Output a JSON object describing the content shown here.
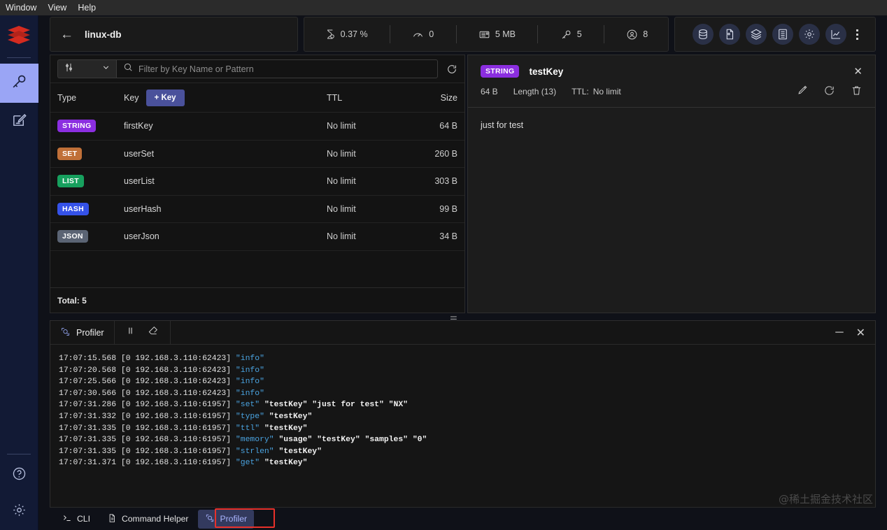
{
  "menubar": {
    "items": [
      "Window",
      "View",
      "Help"
    ]
  },
  "sidebar": {
    "logo": "redis-logo",
    "items": [
      {
        "name": "browser",
        "icon": "key-icon",
        "active": true
      },
      {
        "name": "workbench",
        "icon": "edit-note-icon",
        "active": false
      }
    ],
    "bottom": [
      {
        "name": "help",
        "icon": "question-circle-icon"
      },
      {
        "name": "settings",
        "icon": "gear-icon"
      }
    ]
  },
  "header": {
    "back": "←",
    "db_name": "linux-db",
    "metrics": [
      {
        "icon": "cpu-icon",
        "value": "0.37 %"
      },
      {
        "icon": "gauge-icon",
        "value": "0"
      },
      {
        "icon": "memory-icon",
        "value": "5 MB"
      },
      {
        "icon": "key-icon",
        "value": "5"
      },
      {
        "icon": "clients-icon",
        "value": "8"
      }
    ],
    "tools": [
      "database-icon",
      "report-icon",
      "layers-icon",
      "grid-icon",
      "gear-icon",
      "chart-icon"
    ],
    "overflow": "kebab-icon"
  },
  "keys_panel": {
    "filter": {
      "dropdown_icon": "sliders-icon",
      "chevron": "chevron-down-icon",
      "search_icon": "search-icon",
      "placeholder": "Filter by Key Name or Pattern",
      "value": "",
      "refresh_icon": "refresh-icon"
    },
    "columns": {
      "type": "Type",
      "key": "Key",
      "ttl": "TTL",
      "size": "Size"
    },
    "add_key_label": "+ Key",
    "rows": [
      {
        "type": "STRING",
        "color": "#8b2ee0",
        "key": "firstKey",
        "ttl": "No limit",
        "size": "64 B"
      },
      {
        "type": "SET",
        "color": "#c07038",
        "key": "userSet",
        "ttl": "No limit",
        "size": "260 B"
      },
      {
        "type": "LIST",
        "color": "#17a05e",
        "key": "userList",
        "ttl": "No limit",
        "size": "303 B"
      },
      {
        "type": "HASH",
        "color": "#3552e8",
        "key": "userHash",
        "ttl": "No limit",
        "size": "99 B"
      },
      {
        "type": "JSON",
        "color": "#5b6474",
        "key": "userJson",
        "ttl": "No limit",
        "size": "34 B"
      }
    ],
    "total_label": "Total: 5"
  },
  "detail_panel": {
    "badge": "STRING",
    "badge_color": "#8b2ee0",
    "key_name": "testKey",
    "size": "64 B",
    "length": "Length (13)",
    "ttl_label": "TTL:",
    "ttl_value": "No limit",
    "actions": [
      "edit-icon",
      "refresh-icon",
      "delete-icon"
    ],
    "close": "✕",
    "value": "just for test"
  },
  "profiler": {
    "title": "Profiler",
    "title_icon": "profiler-icon",
    "pause_icon": "pause-icon",
    "clear_icon": "clear-icon",
    "minimize": "─",
    "close": "✕",
    "log": [
      {
        "time": "17:07:15.568",
        "client": "[0 192.168.3.110:62423]",
        "cmd": "\"info\"",
        "args": ""
      },
      {
        "time": "17:07:20.568",
        "client": "[0 192.168.3.110:62423]",
        "cmd": "\"info\"",
        "args": ""
      },
      {
        "time": "17:07:25.566",
        "client": "[0 192.168.3.110:62423]",
        "cmd": "\"info\"",
        "args": ""
      },
      {
        "time": "17:07:30.566",
        "client": "[0 192.168.3.110:62423]",
        "cmd": "\"info\"",
        "args": ""
      },
      {
        "time": "17:07:31.286",
        "client": "[0 192.168.3.110:61957]",
        "cmd": "\"set\"",
        "args": "\"testKey\" \"just for test\" \"NX\""
      },
      {
        "time": "17:07:31.332",
        "client": "[0 192.168.3.110:61957]",
        "cmd": "\"type\"",
        "args": "\"testKey\""
      },
      {
        "time": "17:07:31.335",
        "client": "[0 192.168.3.110:61957]",
        "cmd": "\"ttl\"",
        "args": "\"testKey\""
      },
      {
        "time": "17:07:31.335",
        "client": "[0 192.168.3.110:61957]",
        "cmd": "\"memory\"",
        "args": "\"usage\" \"testKey\" \"samples\" \"0\""
      },
      {
        "time": "17:07:31.335",
        "client": "[0 192.168.3.110:61957]",
        "cmd": "\"strlen\"",
        "args": "\"testKey\""
      },
      {
        "time": "17:07:31.371",
        "client": "[0 192.168.3.110:61957]",
        "cmd": "\"get\"",
        "args": "\"testKey\""
      }
    ]
  },
  "tabs": [
    {
      "label": "CLI",
      "icon": "terminal-icon",
      "active": false
    },
    {
      "label": "Command Helper",
      "icon": "document-icon",
      "active": false
    },
    {
      "label": "Profiler",
      "icon": "profiler-icon",
      "active": true
    }
  ],
  "watermark": "@稀土掘金技术社区"
}
